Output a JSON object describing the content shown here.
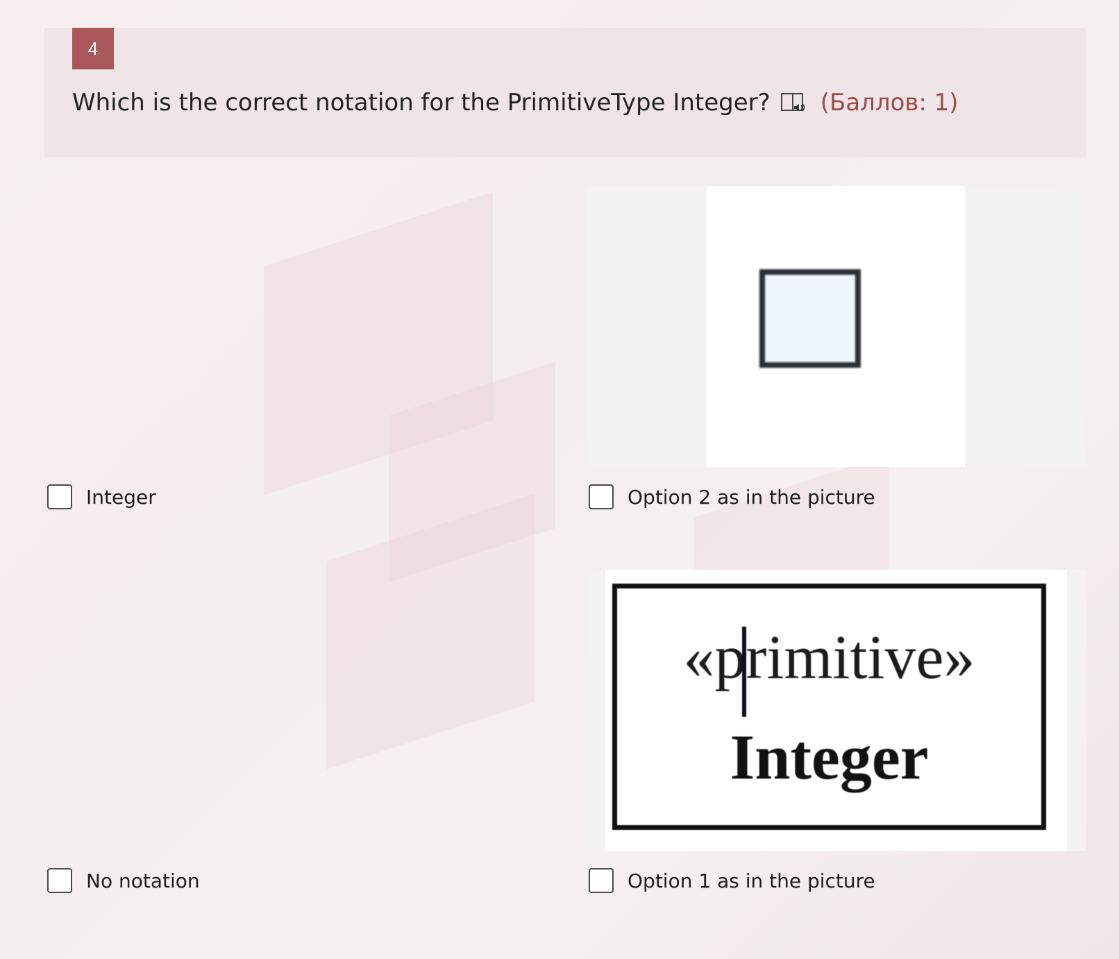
{
  "question": {
    "number": "4",
    "text": "Which is the correct notation for the PrimitiveType Integer?",
    "score": "(Баллов: 1)",
    "audio_icon": "audio-read-icon"
  },
  "options": [
    {
      "label": "Integer",
      "has_image": false
    },
    {
      "label": "Option 2 as in the picture",
      "has_image": true,
      "image_content": "empty-square"
    },
    {
      "label": "No notation",
      "has_image": false
    },
    {
      "label": "Option 1 as in the picture",
      "has_image": true,
      "image_content": {
        "stereotype": "«primitive»",
        "name": "Integer"
      }
    }
  ],
  "colors": {
    "accent": "#a9585c",
    "score_text": "#9b4a4f",
    "header_bg": "#efe5e6"
  }
}
